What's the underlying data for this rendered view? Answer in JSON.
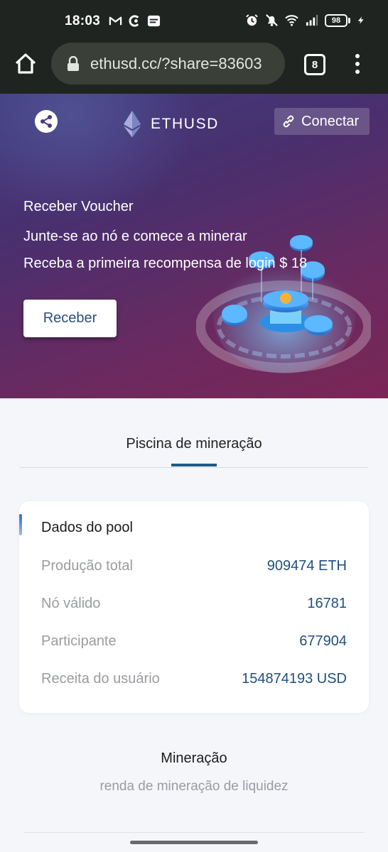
{
  "status_bar": {
    "time": "18:03",
    "battery": "98",
    "left_icons": [
      "gmail-icon",
      "app-c-icon",
      "job-today-icon"
    ],
    "right_icons": [
      "alarm-icon",
      "silent-icon",
      "wifi-icon",
      "signal-icon",
      "charging-icon"
    ]
  },
  "browser": {
    "url": "ethusd.cc/?share=83603",
    "tab_count": "8"
  },
  "hero": {
    "brand": "ETHUSD",
    "connect_label": "Conectar",
    "voucher_title": "Receber Voucher",
    "line1": "Junte-se ao nó e comece a minerar",
    "line2": "Receba a primeira recompensa de login $ 18",
    "receive_label": "Receber"
  },
  "tabs": {
    "active_label": "Piscina de mineração"
  },
  "pool": {
    "title": "Dados do pool",
    "rows": [
      {
        "label": "Produção total",
        "value": "909474 ETH"
      },
      {
        "label": "Nó válido",
        "value": "16781"
      },
      {
        "label": "Participante",
        "value": "677904"
      },
      {
        "label": "Receita do usuário",
        "value": "154874193 USD"
      }
    ]
  },
  "mining": {
    "title": "Mineração",
    "subtitle": "renda de mineração de liquidez"
  },
  "colors": {
    "accent": "#1f5a88",
    "value_text": "#1f4f7e",
    "hero_start": "#3f3b7c",
    "hero_end": "#7a2656"
  }
}
